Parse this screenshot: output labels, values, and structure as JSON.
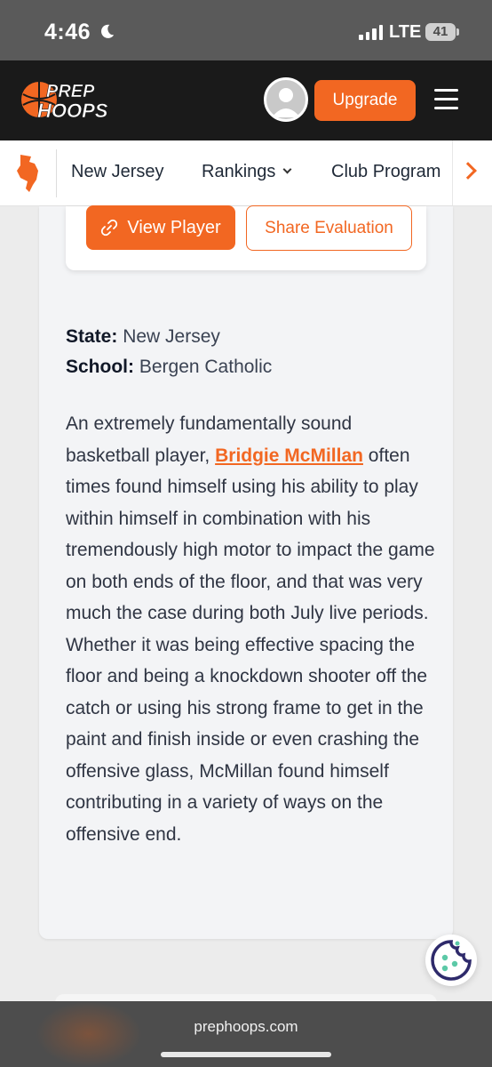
{
  "status_bar": {
    "time": "4:46",
    "network": "LTE",
    "battery": "41"
  },
  "header": {
    "logo_line1": "PREP",
    "logo_line2": "HOOPS",
    "upgrade_label": "Upgrade"
  },
  "nav": {
    "items": [
      {
        "label": "New Jersey"
      },
      {
        "label": "Rankings"
      },
      {
        "label": "Club Program"
      }
    ]
  },
  "evaluation": {
    "view_player_label": "View Player",
    "share_label": "Share Evaluation"
  },
  "article": {
    "state_label": "State:",
    "state_value": "New Jersey",
    "school_label": "School:",
    "school_value": "Bergen Catholic",
    "text_before": "An extremely fundamentally sound basketball player, ",
    "player_name": "Bridgie McMillan",
    "text_after": " often times found himself using his ability to play within himself in combination with his tremendously high motor to impact the game on both ends of the floor, and that was very much the case during both July live periods. Whether it was being effective spacing the floor and being a knockdown shooter off the catch or using his strong frame to get in the paint and finish inside or even crashing the offensive glass, McMillan found himself contributing in a variety of ways on the offensive end."
  },
  "browser": {
    "url": "prephoops.com"
  },
  "colors": {
    "brand_orange": "#f26722",
    "header_bg": "#1a1a1a",
    "cookie_teal": "#5cc9a7",
    "cookie_navy": "#2e2a6b"
  },
  "icons": [
    "moon-icon",
    "signal-icon",
    "battery-icon",
    "logo",
    "avatar-icon",
    "menu-icon",
    "state-map-icon",
    "chevron-down-icon",
    "chevron-right-icon",
    "link-icon",
    "cookie-icon"
  ]
}
